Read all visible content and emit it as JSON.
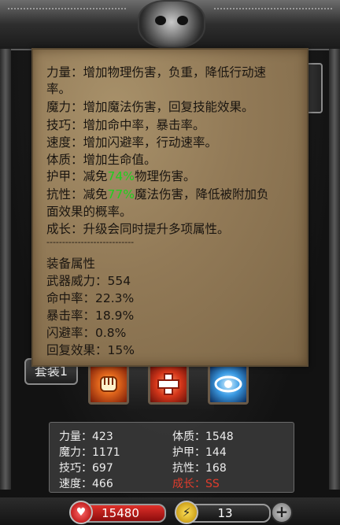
{
  "tooltip": {
    "lines": {
      "strength_1": "力量：增加物理伤害，负重，降低行动速",
      "strength_2": "率。",
      "magic": "魔力：增加魔法伤害，回复技能效果。",
      "skill": "技巧：增加命中率，暴击率。",
      "speed": "速度：增加闪避率，行动速率。",
      "constitution": "体质：增加生命值。",
      "armor_pre": "护甲：减免",
      "armor_pct": "74%",
      "armor_post": "物理伤害。",
      "resist_pre": "抗性：减免",
      "resist_pct": "77%",
      "resist_post": "魔法伤害，降低被附加负",
      "resist_2": "面效果的概率。",
      "growth": "成长：升级会同时提升多项属性。"
    },
    "divider": "----------------------------",
    "equip_title": "装备属性",
    "equip": {
      "weapon_power": "武器威力：554",
      "hit_rate": "命中率：22.3%",
      "crit_rate": "暴击率：18.9%",
      "dodge_rate": "闪避率：0.8%",
      "recovery": "回复效果：15%"
    }
  },
  "set_button": "套装1",
  "stats": {
    "strength": {
      "label": "力量：",
      "value": "423"
    },
    "magic": {
      "label": "魔力：",
      "value": "1171"
    },
    "skill": {
      "label": "技巧：",
      "value": "697"
    },
    "speed": {
      "label": "速度：",
      "value": "466"
    },
    "constitution": {
      "label": "体质：",
      "value": "1548"
    },
    "armor": {
      "label": "护甲：",
      "value": "144"
    },
    "resist": {
      "label": "抗性：",
      "value": "168"
    },
    "growth": {
      "label": "成长：",
      "value": "SS"
    }
  },
  "bottom": {
    "hp": "15480",
    "energy": "13",
    "heart_icon": "heart-icon",
    "bolt_icon": "lightning-icon",
    "plus_icon": "plus-icon"
  },
  "colors": {
    "highlight_green": "#1ed01e",
    "growth_red": "#e03c2c",
    "parchment": "#927a57"
  }
}
